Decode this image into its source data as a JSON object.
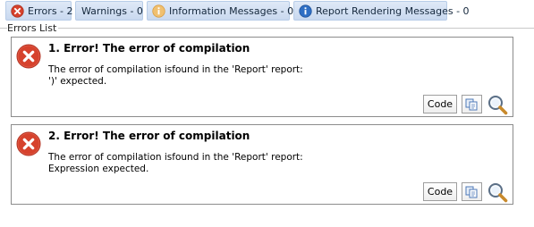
{
  "tabs": [
    {
      "label": "Errors - 2",
      "icon": "error-icon",
      "selected": true
    },
    {
      "label": "Warnings - 0",
      "icon": "",
      "selected": false
    },
    {
      "label": "Information Messages - 0",
      "icon": "information-icon",
      "selected": false
    },
    {
      "label": "Report Rendering Messages - 0",
      "icon": "info-icon",
      "selected": false
    }
  ],
  "group_title": "Errors List",
  "errors": [
    {
      "title": "1. Error! The error of compilation",
      "line1": "The error of compilation isfound in the 'Report' report:",
      "line2": "')' expected.",
      "code_button": "Code"
    },
    {
      "title": "2. Error! The error of compilation",
      "line1": "The error of compilation isfound in the 'Report' report:",
      "line2": "Expression expected.",
      "code_button": "Code"
    }
  ],
  "colors": {
    "tab_bg": "#c9d9ef",
    "error_red": "#d6422d",
    "info_orange": "#e8a33a",
    "info_blue": "#2f6fc4",
    "card_border": "#8c8c8c"
  }
}
